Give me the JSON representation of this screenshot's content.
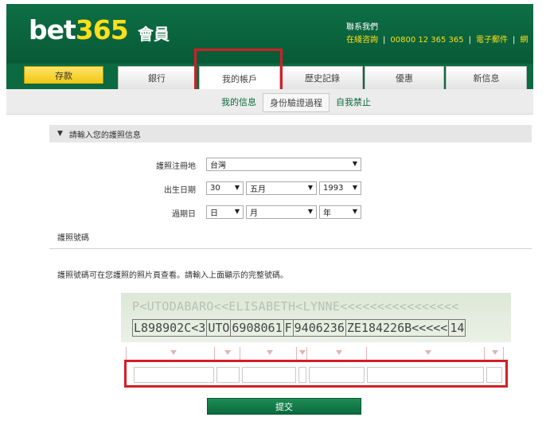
{
  "header": {
    "logo_text": "bet",
    "logo_number": "365",
    "member_label": "會員",
    "contact_title": "聯系我們",
    "contact_items": [
      "在綫咨詢",
      "00800 12 365 365",
      "電子郵件",
      "網"
    ]
  },
  "nav": {
    "tabs": [
      "存款",
      "銀行",
      "我的帳戶",
      "歷史記錄",
      "優惠",
      "新信息"
    ],
    "active_tab": "我的帳戶"
  },
  "subnav": {
    "items": [
      "我的信息",
      "身份驗證過程",
      "自我禁止"
    ],
    "active_item": "身份驗證過程"
  },
  "form": {
    "section_title": "請輸入您的護照信息",
    "country_label": "護照注冊地",
    "country_value": "台灣",
    "dob_label": "出生日期",
    "dob_day": "30",
    "dob_month": "五月",
    "dob_year": "1993",
    "expiry_label": "過期日",
    "expiry_day": "日",
    "expiry_month": "月",
    "expiry_year": "年",
    "passport_number_label": "護照號碼",
    "instruction": "護照號碼可在您護照的照片頁查看。請輸入上面顯示的完整號碼。",
    "submit_label": "提交"
  },
  "mrz": {
    "line1": "P<UTODABARO<<ELISABETH<LYNNE<<<<<<<<<<<<<<<<",
    "segments": [
      "L898902C<3",
      "UTO",
      "6908061",
      "F",
      "9406236",
      "ZE184226B<<<<<",
      "14"
    ]
  },
  "colors": {
    "brand_green": "#0b6a40",
    "brand_yellow": "#ffdf1b",
    "highlight_red": "#d21f26"
  }
}
